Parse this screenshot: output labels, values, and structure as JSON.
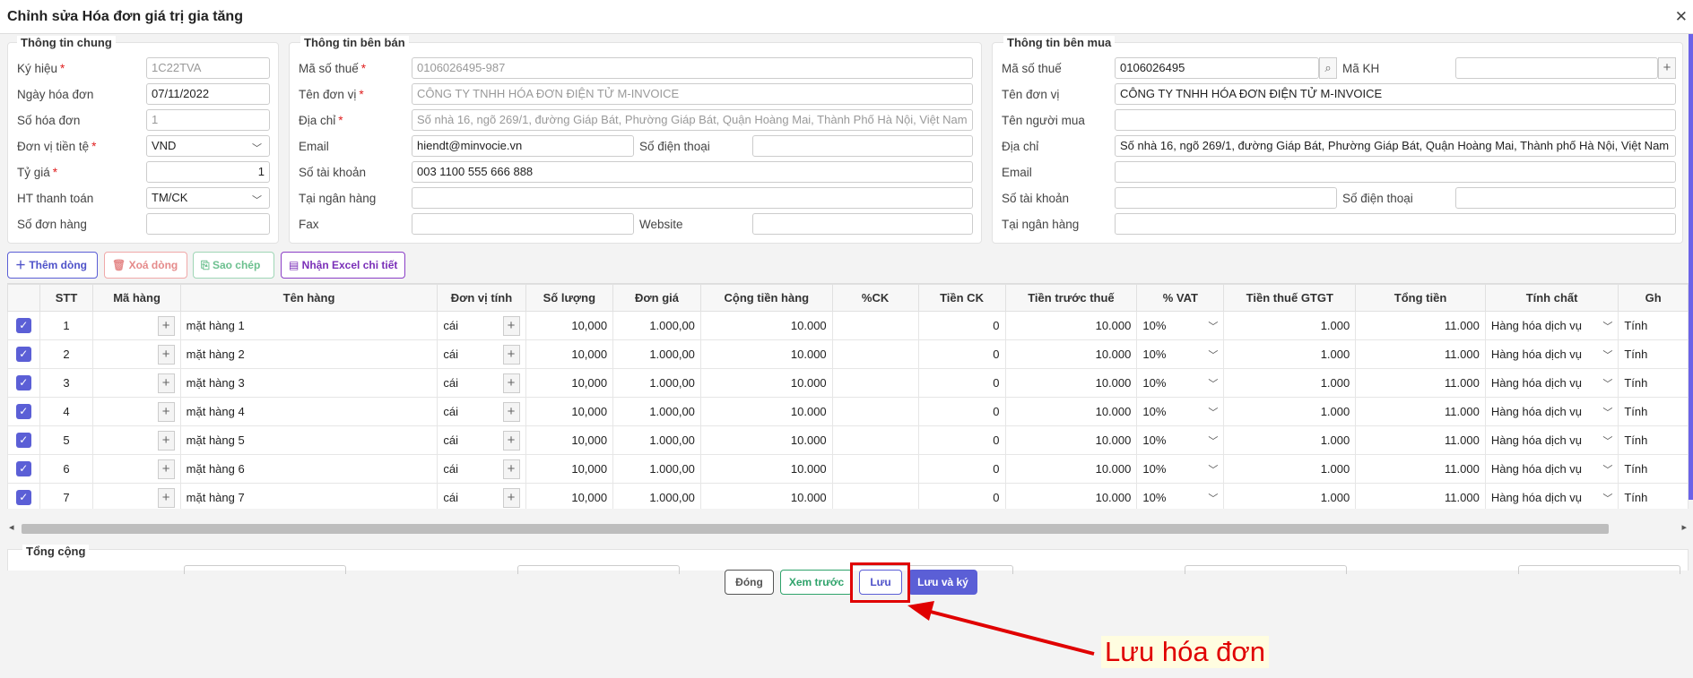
{
  "window": {
    "title": "Chỉnh sửa Hóa đơn giá trị gia tăng",
    "close_glyph": "✕"
  },
  "general": {
    "legend": "Thông tin chung",
    "symbol_label": "Ký hiệu",
    "symbol_value": "1C22TVA",
    "date_label": "Ngày hóa đơn",
    "date_value": "07/11/2022",
    "number_label": "Số hóa đơn",
    "number_value": "1",
    "currency_label": "Đơn vị tiền tệ",
    "currency_value": "VND",
    "rate_label": "Tỷ giá",
    "rate_value": "1",
    "payment_label": "HT thanh toán",
    "payment_value": "TM/CK",
    "order_label": "Số đơn hàng",
    "order_value": ""
  },
  "seller": {
    "legend": "Thông tin bên bán",
    "tax_label": "Mã số thuế",
    "tax_value": "0106026495-987",
    "name_label": "Tên đơn vị",
    "name_value": "CÔNG TY TNHH HÓA ĐƠN ĐIỆN TỬ M-INVOICE",
    "address_label": "Địa chỉ",
    "address_value": "Số nhà 16, ngõ 269/1, đường Giáp Bát, Phường Giáp Bát, Quận Hoàng Mai, Thành Phố Hà Nội, Việt Nam",
    "email_label": "Email",
    "email_value": "hiendt@minvocie.vn",
    "phone_label": "Số điện thoại",
    "phone_value": "",
    "account_label": "Số tài khoản",
    "account_value": "003 1100 555 666 888",
    "bank_label": "Tại ngân hàng",
    "bank_value": "",
    "fax_label": "Fax",
    "fax_value": "",
    "website_label": "Website",
    "website_value": ""
  },
  "buyer": {
    "legend": "Thông tin bên mua",
    "tax_label": "Mã số thuế",
    "tax_value": "0106026495",
    "code_label": "Mã KH",
    "code_value": "",
    "name_label": "Tên đơn vị",
    "name_value": "CÔNG TY TNHH HÓA ĐƠN ĐIỆN TỬ M-INVOICE",
    "buyer_label": "Tên người mua",
    "buyer_value": "",
    "address_label": "Địa chỉ",
    "address_value": "Số nhà 16, ngõ 269/1, đường Giáp Bát, Phường Giáp Bát, Quận Hoàng Mai, Thành phố Hà Nội, Việt Nam",
    "email_label": "Email",
    "email_value": "",
    "account_label": "Số tài khoản",
    "account_value": "",
    "phone_label": "Số điện thoại",
    "phone_value": "",
    "bank_label": "Tại ngân hàng",
    "bank_value": ""
  },
  "toolbar": {
    "add_row": "Thêm dòng",
    "delete_row": "Xoá dòng",
    "copy": "Sao chép",
    "import_excel": "Nhận Excel chi tiết"
  },
  "grid": {
    "headers": [
      "",
      "STT",
      "Mã hàng",
      "Tên hàng",
      "Đơn vị tính",
      "Số lượng",
      "Đơn giá",
      "Cộng tiền hàng",
      "%CK",
      "Tiền CK",
      "Tiền trước thuế",
      "% VAT",
      "Tiền thuế GTGT",
      "Tổng tiền",
      "Tính chất",
      "Gh"
    ],
    "rows": [
      {
        "stt": "1",
        "name": "mặt hàng 1",
        "unit": "cái",
        "qty": "10,000",
        "price": "1.000,00",
        "amount": "10.000",
        "ck": "",
        "ck_amount": "0",
        "pretax": "10.000",
        "vat": "10%",
        "vat_amount": "1.000",
        "total": "11.000",
        "nature": "Hàng hóa dịch vụ",
        "note": "Tính"
      },
      {
        "stt": "2",
        "name": "mặt hàng 2",
        "unit": "cái",
        "qty": "10,000",
        "price": "1.000,00",
        "amount": "10.000",
        "ck": "",
        "ck_amount": "0",
        "pretax": "10.000",
        "vat": "10%",
        "vat_amount": "1.000",
        "total": "11.000",
        "nature": "Hàng hóa dịch vụ",
        "note": "Tính"
      },
      {
        "stt": "3",
        "name": "mặt hàng 3",
        "unit": "cái",
        "qty": "10,000",
        "price": "1.000,00",
        "amount": "10.000",
        "ck": "",
        "ck_amount": "0",
        "pretax": "10.000",
        "vat": "10%",
        "vat_amount": "1.000",
        "total": "11.000",
        "nature": "Hàng hóa dịch vụ",
        "note": "Tính"
      },
      {
        "stt": "4",
        "name": "mặt hàng 4",
        "unit": "cái",
        "qty": "10,000",
        "price": "1.000,00",
        "amount": "10.000",
        "ck": "",
        "ck_amount": "0",
        "pretax": "10.000",
        "vat": "10%",
        "vat_amount": "1.000",
        "total": "11.000",
        "nature": "Hàng hóa dịch vụ",
        "note": "Tính"
      },
      {
        "stt": "5",
        "name": "mặt hàng 5",
        "unit": "cái",
        "qty": "10,000",
        "price": "1.000,00",
        "amount": "10.000",
        "ck": "",
        "ck_amount": "0",
        "pretax": "10.000",
        "vat": "10%",
        "vat_amount": "1.000",
        "total": "11.000",
        "nature": "Hàng hóa dịch vụ",
        "note": "Tính"
      },
      {
        "stt": "6",
        "name": "mặt hàng 6",
        "unit": "cái",
        "qty": "10,000",
        "price": "1.000,00",
        "amount": "10.000",
        "ck": "",
        "ck_amount": "0",
        "pretax": "10.000",
        "vat": "10%",
        "vat_amount": "1.000",
        "total": "11.000",
        "nature": "Hàng hóa dịch vụ",
        "note": "Tính"
      },
      {
        "stt": "7",
        "name": "mặt hàng 7",
        "unit": "cái",
        "qty": "10,000",
        "price": "1.000,00",
        "amount": "10.000",
        "ck": "",
        "ck_amount": "0",
        "pretax": "10.000",
        "vat": "10%",
        "vat_amount": "1.000",
        "total": "11.000",
        "nature": "Hàng hóa dịch vụ",
        "note": "Tính"
      }
    ]
  },
  "totals": {
    "legend": "Tổng cộng"
  },
  "footer": {
    "close": "Đóng",
    "preview": "Xem trước",
    "save": "Lưu",
    "save_sign": "Lưu và ký"
  },
  "annotation": {
    "text": "Lưu hóa đơn"
  },
  "colors": {
    "accent": "#6b63e8",
    "danger": "#e00000",
    "success": "#2fa36b",
    "purple": "#8b3fc7"
  }
}
